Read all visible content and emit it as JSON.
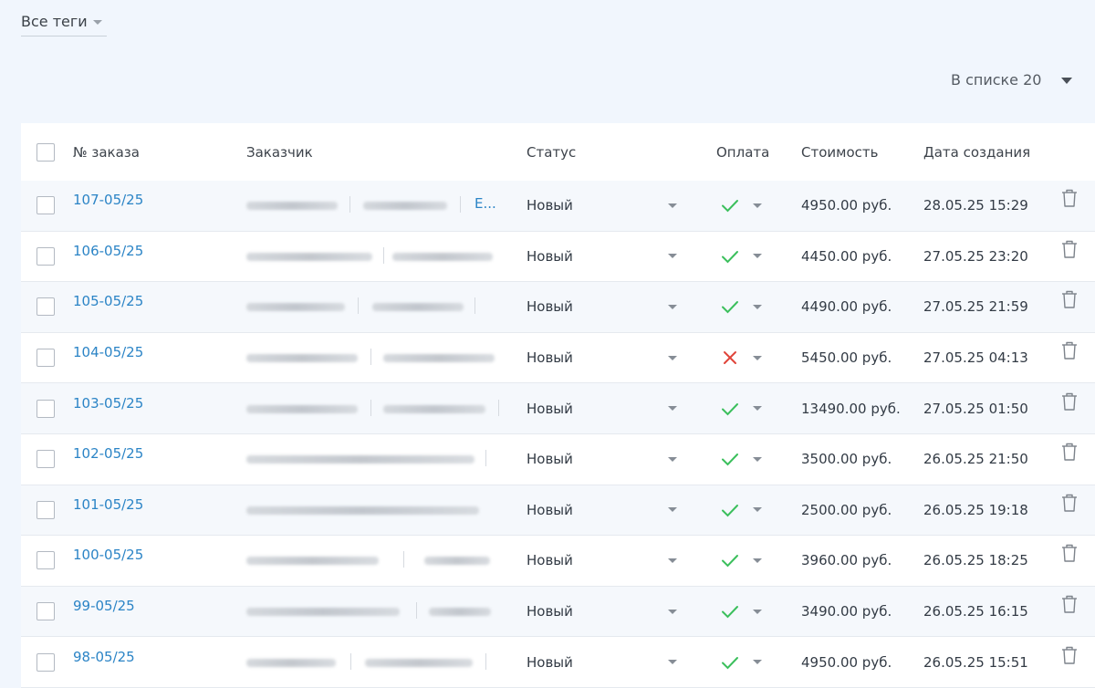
{
  "filters": {
    "tags_label": "Все теги",
    "per_page_label": "В списке 20"
  },
  "table": {
    "headers": {
      "order_no": "№ заказа",
      "customer": "Заказчик",
      "status": "Статус",
      "payment": "Оплата",
      "cost": "Стоимость",
      "created": "Дата создания"
    },
    "rows": [
      {
        "order": "107-05/25",
        "status": "Новый",
        "paid": true,
        "cost": "4950.00 руб.",
        "date": "28.05.25 15:29",
        "email_hint": "E..."
      },
      {
        "order": "106-05/25",
        "status": "Новый",
        "paid": true,
        "cost": "4450.00 руб.",
        "date": "27.05.25 23:20"
      },
      {
        "order": "105-05/25",
        "status": "Новый",
        "paid": true,
        "cost": "4490.00 руб.",
        "date": "27.05.25 21:59"
      },
      {
        "order": "104-05/25",
        "status": "Новый",
        "paid": false,
        "cost": "5450.00 руб.",
        "date": "27.05.25 04:13"
      },
      {
        "order": "103-05/25",
        "status": "Новый",
        "paid": true,
        "cost": "13490.00 руб.",
        "date": "27.05.25 01:50"
      },
      {
        "order": "102-05/25",
        "status": "Новый",
        "paid": true,
        "cost": "3500.00 руб.",
        "date": "26.05.25 21:50"
      },
      {
        "order": "101-05/25",
        "status": "Новый",
        "paid": true,
        "cost": "2500.00 руб.",
        "date": "26.05.25 19:18"
      },
      {
        "order": "100-05/25",
        "status": "Новый",
        "paid": true,
        "cost": "3960.00 руб.",
        "date": "26.05.25 18:25"
      },
      {
        "order": "99-05/25",
        "status": "Новый",
        "paid": true,
        "cost": "3490.00 руб.",
        "date": "26.05.25 16:15"
      },
      {
        "order": "98-05/25",
        "status": "Новый",
        "paid": true,
        "cost": "4950.00 руб.",
        "date": "26.05.25 15:51"
      }
    ]
  },
  "colors": {
    "link": "#2b84c6",
    "paid_check": "#3bbf5c",
    "unpaid_cross": "#e0443a",
    "page_bg": "#f1f6fd"
  },
  "icons": {
    "paid": "check-icon",
    "unpaid": "cross-icon",
    "delete": "trash-icon",
    "dropdown": "chevron-down-icon"
  }
}
